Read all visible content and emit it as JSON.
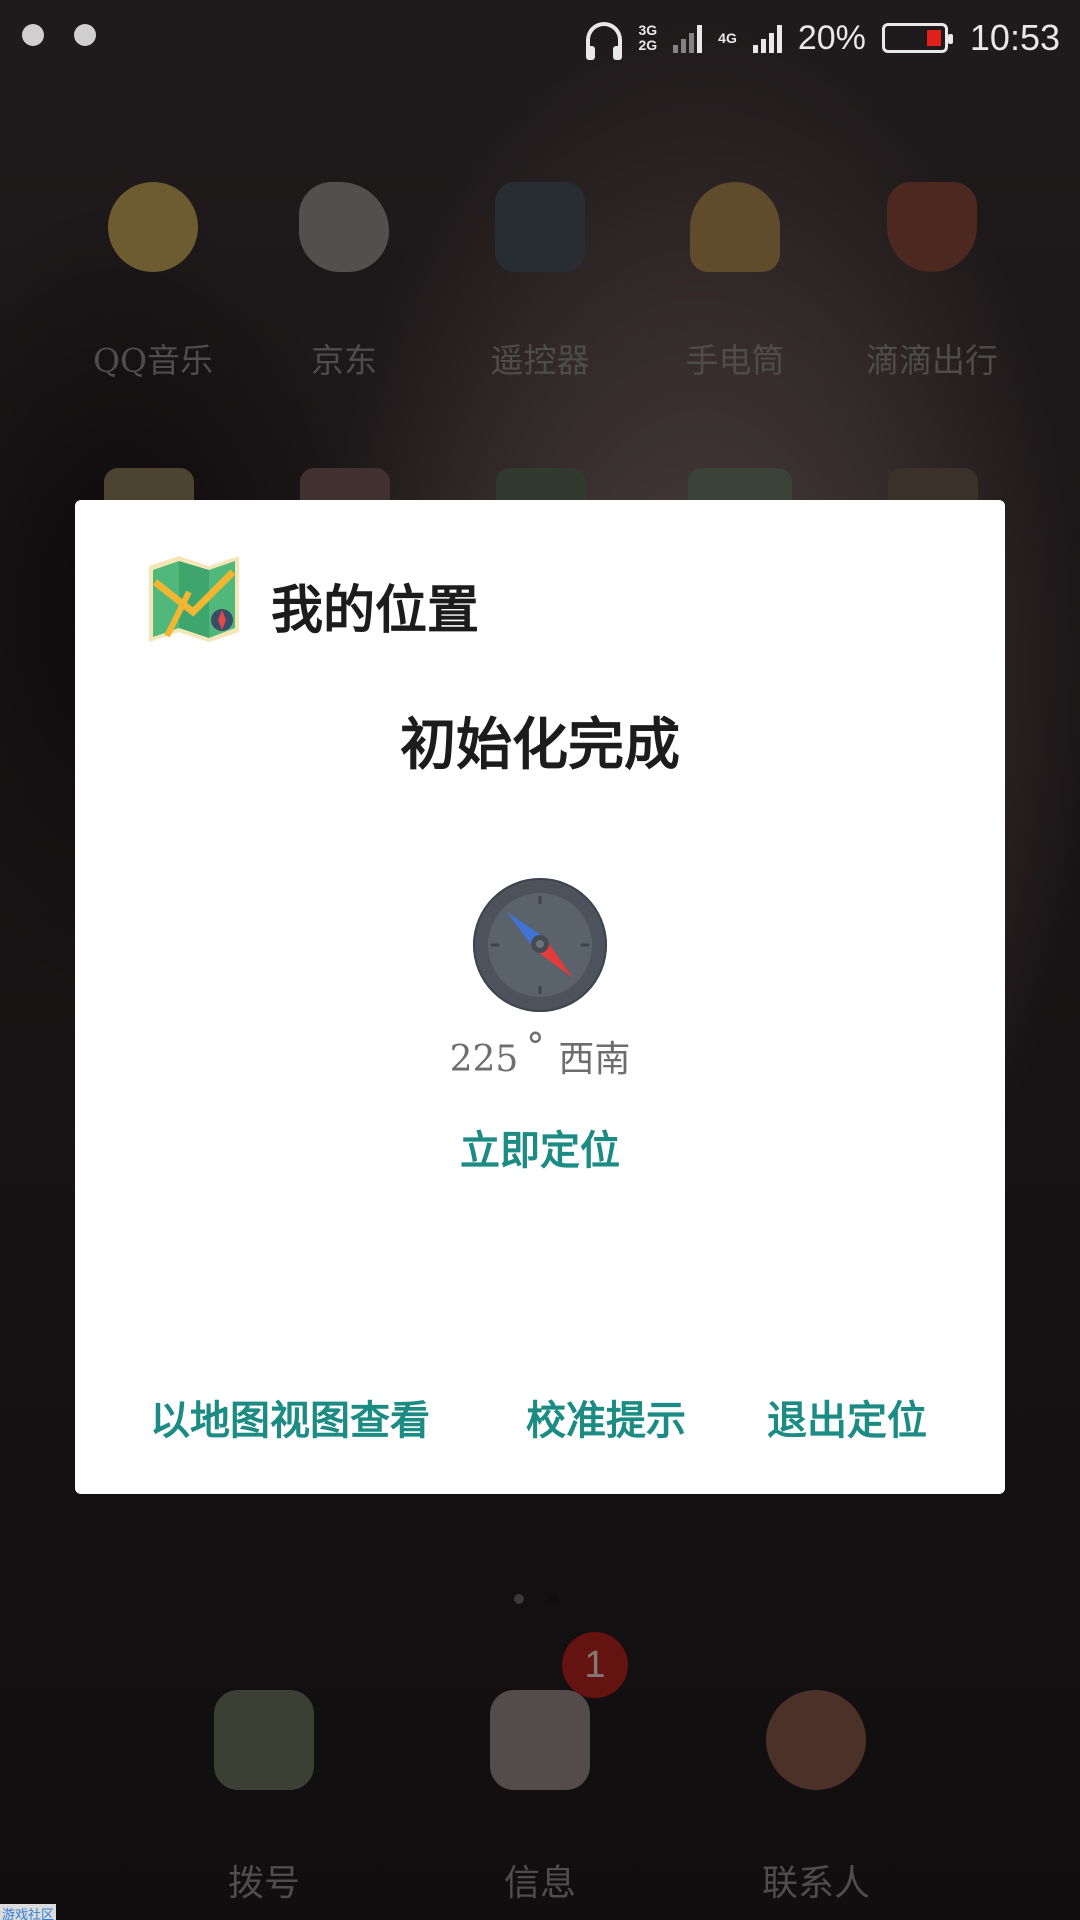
{
  "status_bar": {
    "network_primary": [
      "3G",
      "2G"
    ],
    "network_secondary": "4G",
    "battery_percent": "20%",
    "time": "10:53",
    "icons": [
      "notification-icon-1",
      "notification-icon-2",
      "headset-icon",
      "signal-icon",
      "battery-icon"
    ]
  },
  "home_apps": [
    {
      "label": "QQ音乐",
      "icon": "qq-music-icon"
    },
    {
      "label": "京东",
      "icon": "jd-icon"
    },
    {
      "label": "遥控器",
      "icon": "remote-icon"
    },
    {
      "label": "手电筒",
      "icon": "flashlight-icon"
    },
    {
      "label": "滴滴出行",
      "icon": "didi-icon"
    }
  ],
  "dialog": {
    "app_icon": "map-icon",
    "title": "我的位置",
    "status": "初始化完成",
    "compass": {
      "icon": "compass-icon",
      "degrees": "225",
      "degree_symbol": "°",
      "direction": "西南"
    },
    "locate_now": "立即定位",
    "actions": {
      "map_view": "以地图视图查看",
      "calibration": "校准提示",
      "exit": "退出定位"
    },
    "accent_color": "#1b8b83"
  },
  "dock": {
    "apps": [
      {
        "label": "拨号",
        "icon": "phone-icon"
      },
      {
        "label": "信息",
        "icon": "messages-icon"
      },
      {
        "label": "联系人",
        "icon": "contacts-icon"
      }
    ],
    "messages_badge": "1"
  },
  "watermark": "游戏社区"
}
